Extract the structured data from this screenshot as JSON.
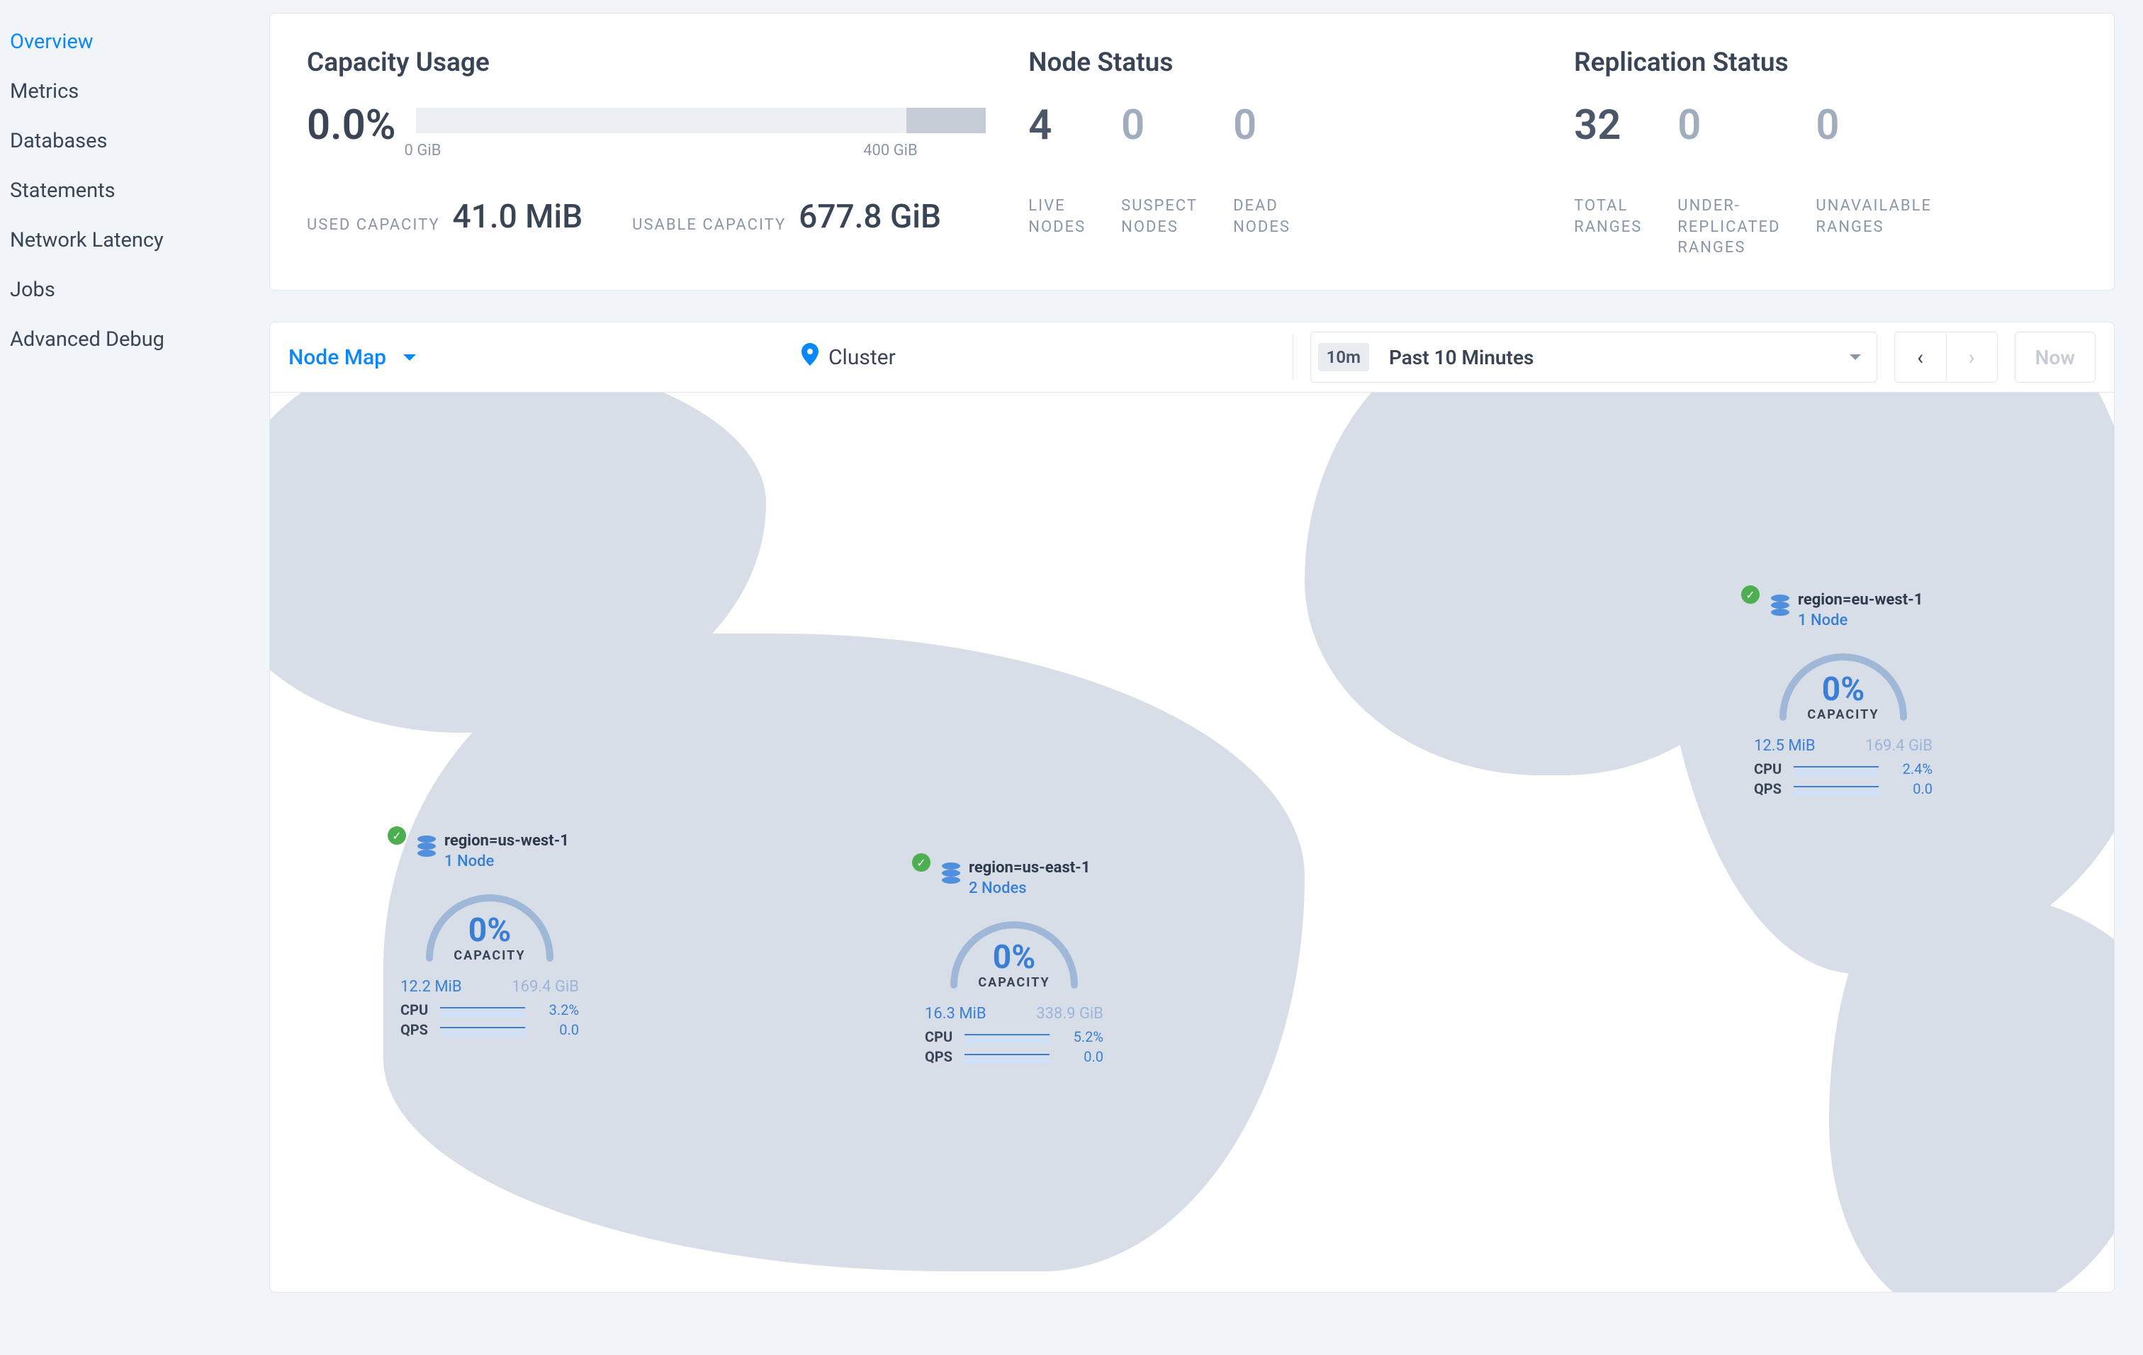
{
  "sidebar": {
    "items": [
      {
        "label": "Overview",
        "active": true
      },
      {
        "label": "Metrics",
        "active": false
      },
      {
        "label": "Databases",
        "active": false
      },
      {
        "label": "Statements",
        "active": false
      },
      {
        "label": "Network Latency",
        "active": false
      },
      {
        "label": "Jobs",
        "active": false
      },
      {
        "label": "Advanced Debug",
        "active": false
      }
    ]
  },
  "summary": {
    "capacity": {
      "title": "Capacity Usage",
      "percent": "0.0%",
      "bar_ticks": [
        "0 GiB",
        "400 GiB"
      ],
      "used_label": "USED CAPACITY",
      "used_value": "41.0 MiB",
      "usable_label": "USABLE CAPACITY",
      "usable_value": "677.8 GiB"
    },
    "nodes": {
      "title": "Node Status",
      "stats": [
        {
          "value": "4",
          "label": "LIVE NODES"
        },
        {
          "value": "0",
          "label": "SUSPECT NODES"
        },
        {
          "value": "0",
          "label": "DEAD NODES"
        }
      ]
    },
    "replication": {
      "title": "Replication Status",
      "stats": [
        {
          "value": "32",
          "label": "TOTAL RANGES"
        },
        {
          "value": "0",
          "label": "UNDER-REPLICATED RANGES"
        },
        {
          "value": "0",
          "label": "UNAVAILABLE RANGES"
        }
      ]
    }
  },
  "controls": {
    "view": "Node Map",
    "breadcrumb": "Cluster",
    "time_chip": "10m",
    "time_label": "Past 10 Minutes",
    "now_label": "Now"
  },
  "regions": [
    {
      "id": "us-west-1",
      "title": "region=us-west-1",
      "nodes": "1 Node",
      "capacity_pct": "0%",
      "capacity_label": "CAPACITY",
      "used": "12.2 MiB",
      "total": "169.4 GiB",
      "metrics": [
        {
          "label": "CPU",
          "value": "3.2%"
        },
        {
          "label": "QPS",
          "value": "0.0"
        }
      ],
      "pos": {
        "left": 170,
        "top": 620
      }
    },
    {
      "id": "us-east-1",
      "title": "region=us-east-1",
      "nodes": "2 Nodes",
      "capacity_pct": "0%",
      "capacity_label": "CAPACITY",
      "used": "16.3 MiB",
      "total": "338.9 GiB",
      "metrics": [
        {
          "label": "CPU",
          "value": "5.2%"
        },
        {
          "label": "QPS",
          "value": "0.0"
        }
      ],
      "pos": {
        "left": 910,
        "top": 658
      }
    },
    {
      "id": "eu-west-1",
      "title": "region=eu-west-1",
      "nodes": "1 Node",
      "capacity_pct": "0%",
      "capacity_label": "CAPACITY",
      "used": "12.5 MiB",
      "total": "169.4 GiB",
      "metrics": [
        {
          "label": "CPU",
          "value": "2.4%"
        },
        {
          "label": "QPS",
          "value": "0.0"
        }
      ],
      "pos": {
        "left": 2080,
        "top": 280
      }
    }
  ],
  "chart_data": {
    "type": "bar",
    "title": "Capacity Usage",
    "categories": [
      "Used",
      "Usable"
    ],
    "values": [
      0.04003906,
      677.8
    ],
    "unit": "GiB",
    "ylim": [
      0,
      700
    ],
    "tick_labels": [
      "0 GiB",
      "400 GiB"
    ],
    "regions_gauges": [
      {
        "name": "region=us-west-1",
        "capacity_pct": 0,
        "used_mib": 12.2,
        "total_gib": 169.4,
        "cpu_pct": 3.2,
        "qps": 0.0
      },
      {
        "name": "region=us-east-1",
        "capacity_pct": 0,
        "used_mib": 16.3,
        "total_gib": 338.9,
        "cpu_pct": 5.2,
        "qps": 0.0
      },
      {
        "name": "region=eu-west-1",
        "capacity_pct": 0,
        "used_mib": 12.5,
        "total_gib": 169.4,
        "cpu_pct": 2.4,
        "qps": 0.0
      }
    ]
  }
}
